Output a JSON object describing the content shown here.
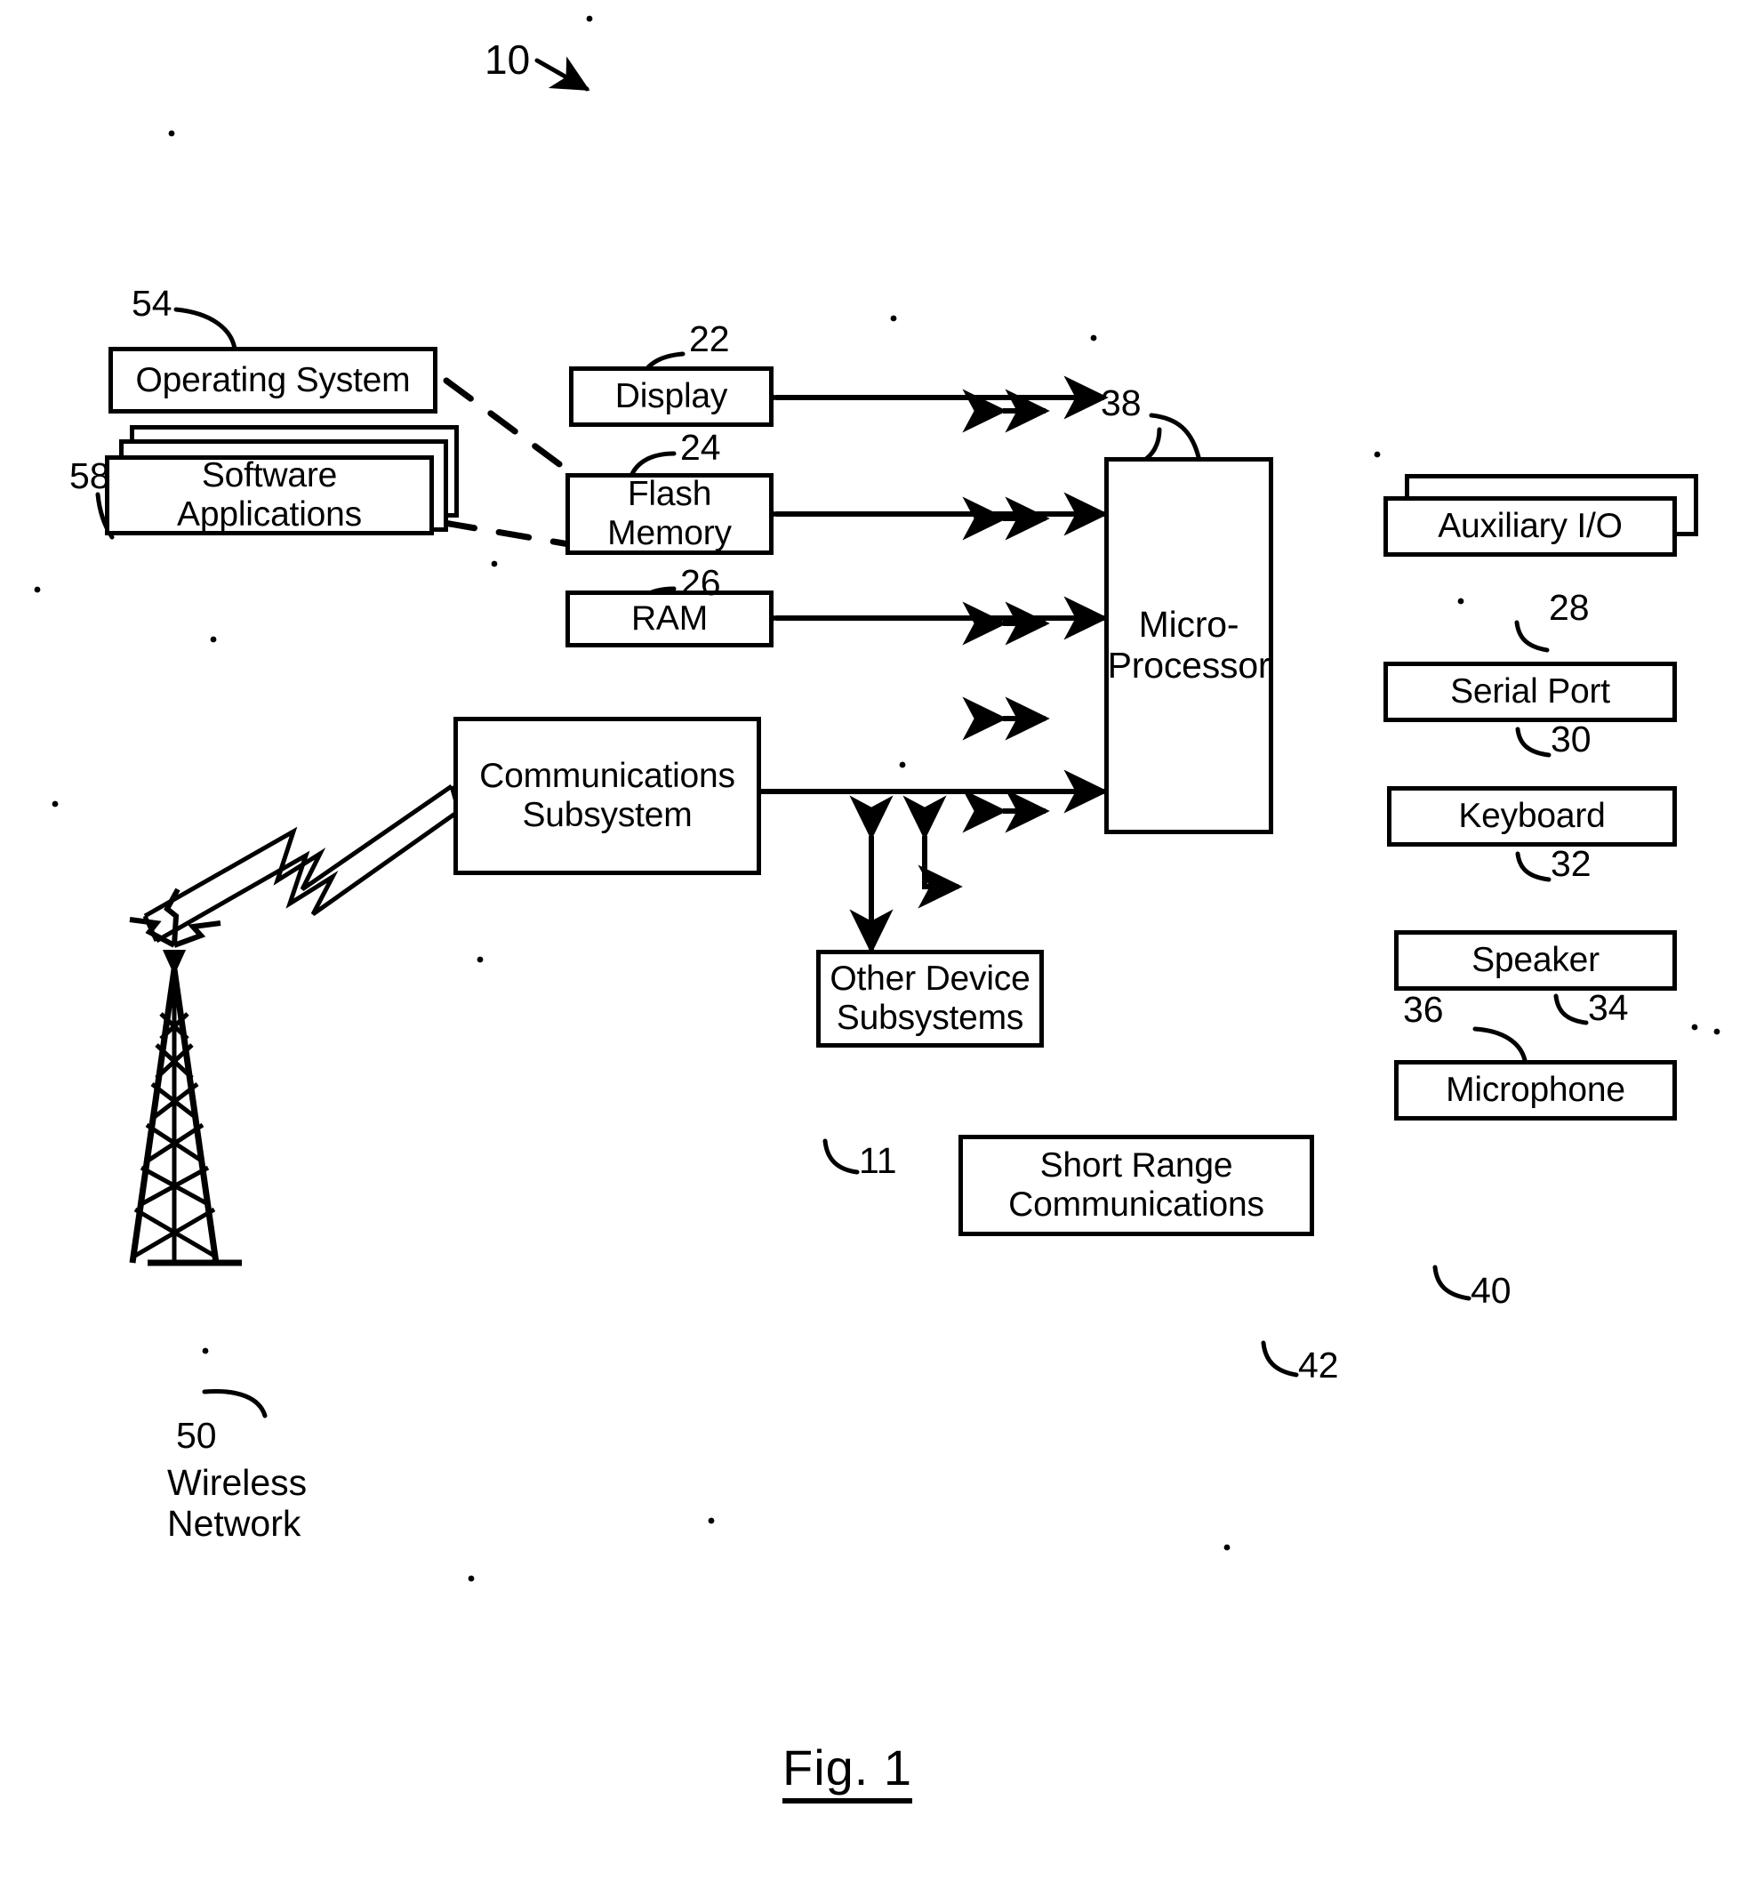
{
  "figure": {
    "caption": "Fig. 1",
    "system_ref": "10"
  },
  "nodes": {
    "operating_system": {
      "label": "Operating System",
      "ref": "54"
    },
    "software_applications": {
      "label": "Software\nApplications",
      "ref": "58"
    },
    "display": {
      "label": "Display",
      "ref": "22"
    },
    "flash_memory": {
      "label": "Flash\nMemory",
      "ref": "24"
    },
    "ram": {
      "label": "RAM",
      "ref": "26"
    },
    "microprocessor": {
      "label": "Micro-\nProcessor",
      "ref": "38"
    },
    "auxiliary_io": {
      "label": "Auxiliary I/O",
      "ref": "28"
    },
    "serial_port": {
      "label": "Serial Port",
      "ref": "30"
    },
    "keyboard": {
      "label": "Keyboard",
      "ref": "32"
    },
    "speaker": {
      "label": "Speaker",
      "ref": "34"
    },
    "microphone": {
      "label": "Microphone",
      "ref": "36"
    },
    "short_range_communications": {
      "label": "Short Range\nCommunications",
      "ref": "40"
    },
    "other_device_subsystems": {
      "label": "Other Device\nSubsystems",
      "ref": "42"
    },
    "communications_subsystem": {
      "label": "Communications\nSubsystem",
      "ref": "11"
    },
    "wireless_network": {
      "label": "Wireless\nNetwork",
      "ref": "50"
    }
  },
  "colors": {
    "ink": "#000000",
    "paper": "#ffffff"
  }
}
